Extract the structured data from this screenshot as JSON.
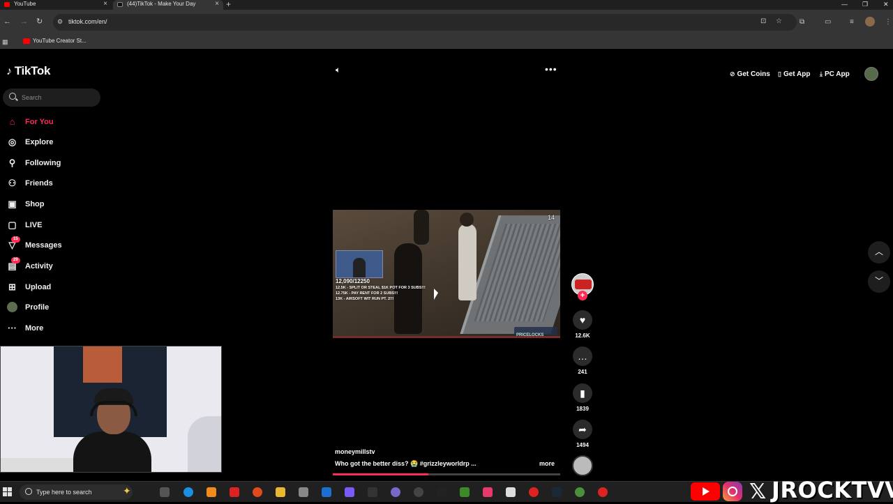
{
  "browser": {
    "tabs": [
      {
        "title": "YouTube"
      },
      {
        "title": "(44)TikTok - Make Your Day"
      }
    ],
    "new_tab": "+",
    "url": "tiktok.com/en/",
    "bookmarks": [
      {
        "label": "YouTube Creator St..."
      }
    ]
  },
  "tiktok": {
    "logo": "TikTok",
    "search_placeholder": "Search",
    "nav": [
      {
        "label": "For You",
        "icon": "home-icon",
        "active": true
      },
      {
        "label": "Explore",
        "icon": "compass-icon"
      },
      {
        "label": "Following",
        "icon": "following-icon"
      },
      {
        "label": "Friends",
        "icon": "friends-icon"
      },
      {
        "label": "Shop",
        "icon": "shop-icon"
      },
      {
        "label": "LIVE",
        "icon": "live-icon"
      },
      {
        "label": "Messages",
        "icon": "messages-icon",
        "badge": "15"
      },
      {
        "label": "Activity",
        "icon": "activity-icon",
        "badge": "29"
      },
      {
        "label": "Upload",
        "icon": "upload-icon"
      },
      {
        "label": "Profile",
        "icon": "avatar"
      },
      {
        "label": "More",
        "icon": "more-icon"
      }
    ],
    "top_actions": {
      "get_coins": "Get Coins",
      "get_app": "Get App",
      "pc_app": "PC App"
    },
    "video": {
      "overlay_number": "14",
      "goal": "12,090/12250",
      "goal_lines": [
        "12.5K - SPLIT OR STEAL $1K POT FOR 3 SUBS!!!",
        "12.75K - PAY RENT FOR 2 SUBS!!!",
        "13K - AIRSOFT WIT RUN PT. 2!!!"
      ],
      "watermark": "PRICELOCKS"
    },
    "actions": {
      "likes": "12.6K",
      "comments": "241",
      "saves": "1839",
      "shares": "1494"
    },
    "author": "moneymillstv",
    "caption": "Who got the better diss? 😭 #grizzleyworldrp ...",
    "more_label": "more",
    "progress": 0.42
  },
  "taskbar": {
    "search_placeholder": "Type here to search"
  },
  "watermark": {
    "name": "JROCKTVV"
  },
  "colors": {
    "accent": "#fe2c55",
    "background": "#000000",
    "taskbar": "#202020"
  }
}
